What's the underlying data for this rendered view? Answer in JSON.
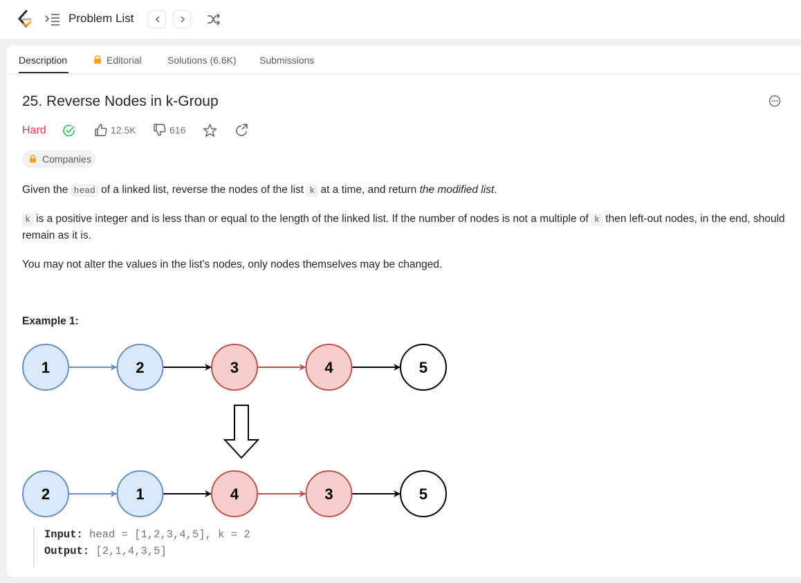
{
  "topbar": {
    "nav_label": "Problem List"
  },
  "tabs": [
    {
      "label": "Description"
    },
    {
      "label": "Editorial"
    },
    {
      "label": "Solutions (6.6K)"
    },
    {
      "label": "Submissions"
    }
  ],
  "problem": {
    "title": "25. Reverse Nodes in k-Group",
    "difficulty": "Hard",
    "difficulty_color": "#e83848",
    "likes": "12.5K",
    "dislikes": "616",
    "companies_label": "Companies",
    "desc1": {
      "t1": "Given the ",
      "c1": "head",
      "t2": " of a linked list, reverse the nodes of the list ",
      "c2": "k",
      "t3": " at a time, and return ",
      "em": "the modified list",
      "t4": "."
    },
    "desc2": {
      "c1": "k",
      "t1": " is a positive integer and is less than or equal to the length of the linked list. If the number of nodes is not a multiple of ",
      "c2": "k",
      "t2": " then left-out nodes, in the end, should remain as it is."
    },
    "desc3": "You may not alter the values in the list's nodes, only nodes themselves may be changed."
  },
  "example": {
    "title": "Example 1:",
    "before_nodes": [
      "1",
      "2",
      "3",
      "4",
      "5"
    ],
    "after_nodes": [
      "2",
      "1",
      "4",
      "3",
      "5"
    ],
    "input_label": "Input:",
    "input_value": " head = [1,2,3,4,5], k = 2",
    "output_label": "Output:",
    "output_value": " [2,1,4,3,5]"
  },
  "colors": {
    "blue_fill": "#dae8fc",
    "blue_stroke": "#6c8ebf",
    "red_fill": "#f8cecc",
    "red_stroke": "#b85450",
    "accent_orange": "#ffa116"
  },
  "icons": [
    "leetcode-logo",
    "list-icon",
    "chevron-left-icon",
    "chevron-right-icon",
    "shuffle-icon",
    "lock-icon",
    "check-circle-icon",
    "thumbs-up-icon",
    "thumbs-down-icon",
    "star-icon",
    "share-icon",
    "more-icon"
  ]
}
